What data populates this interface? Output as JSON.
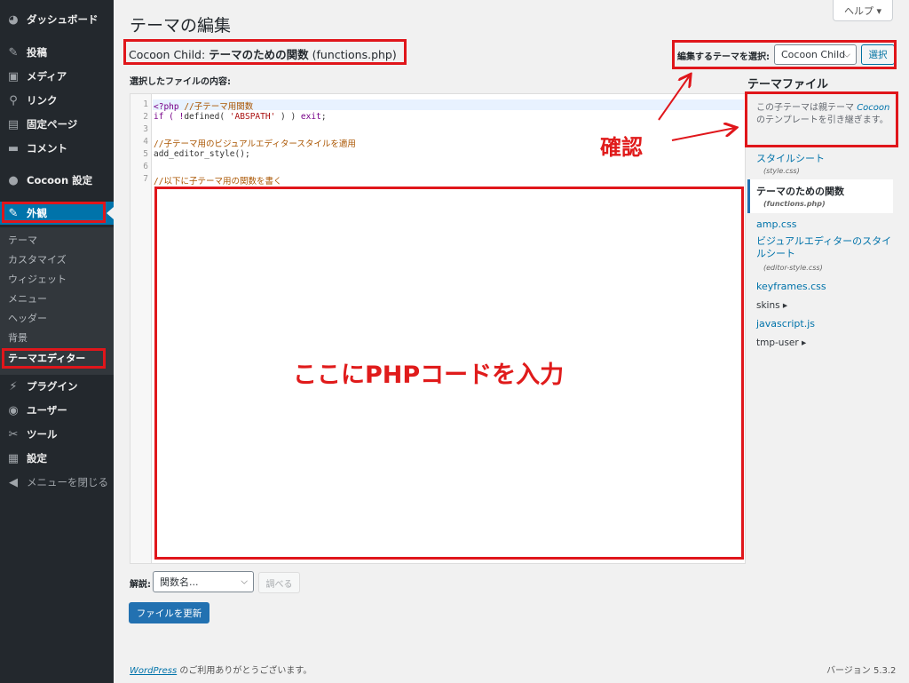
{
  "sidebar": {
    "items": [
      {
        "label": "ダッシュボード",
        "icon": "dashboard-icon",
        "glyph": "◕"
      },
      {
        "label": "投稿",
        "icon": "pin-icon",
        "glyph": "✎"
      },
      {
        "label": "メディア",
        "icon": "media-icon",
        "glyph": "▣"
      },
      {
        "label": "リンク",
        "icon": "link-icon",
        "glyph": "⚲"
      },
      {
        "label": "固定ページ",
        "icon": "page-icon",
        "glyph": "▤"
      },
      {
        "label": "コメント",
        "icon": "comment-icon",
        "glyph": "▬"
      },
      {
        "label": "Cocoon 設定",
        "icon": "circle-icon",
        "glyph": "●"
      },
      {
        "label": "外観",
        "icon": "appearance-icon",
        "glyph": "✎"
      },
      {
        "label": "プラグイン",
        "icon": "plugin-icon",
        "glyph": "⚡"
      },
      {
        "label": "ユーザー",
        "icon": "user-icon",
        "glyph": "◉"
      },
      {
        "label": "ツール",
        "icon": "tools-icon",
        "glyph": "✂"
      },
      {
        "label": "設定",
        "icon": "settings-icon",
        "glyph": "▦"
      },
      {
        "label": "メニューを閉じる",
        "icon": "collapse-icon",
        "glyph": "◀"
      }
    ],
    "submenu": [
      "テーマ",
      "カスタマイズ",
      "ウィジェット",
      "メニュー",
      "ヘッダー",
      "背景",
      "テーマエディター"
    ]
  },
  "header": {
    "title": "テーマの編集",
    "help": "ヘルプ ▾"
  },
  "file_heading": {
    "prefix": "Cocoon Child: ",
    "name": "テーマのための関数",
    "file": " (functions.php)"
  },
  "theme_select": {
    "label": "編集するテーマを選択:",
    "value": "Cocoon Child",
    "button": "選択"
  },
  "content_label": "選択したファイルの内容:",
  "editor": {
    "line_numbers": [
      "1",
      "2",
      "3",
      "4",
      "5",
      "6",
      "7"
    ],
    "lines": {
      "l1a": "<?php ",
      "l1b": "//子テーマ用関数",
      "l2a": "if ( !",
      "l2b": "defined",
      "l2c": "( ",
      "l2d": "'ABSPATH'",
      "l2e": " ) ) ",
      "l2f": "exit",
      "l2g": ";",
      "l4": "//子テーマ用のビジュアルエディタースタイルを適用",
      "l5": "add_editor_style();",
      "l7": "//以下に子テーマ用の関数を書く"
    }
  },
  "annotations": {
    "input_here": "ここにPHPコードを入力",
    "confirm": "確認"
  },
  "theme_files": {
    "title": "テーマファイル",
    "desc_a": "この子テーマは親テーマ ",
    "desc_parent": "Cocoon",
    "desc_b": " のテンプレートを引き継ぎます。",
    "items": [
      {
        "label": "スタイルシート",
        "sub": "(style.css)"
      },
      {
        "label": "テーマのための関数",
        "sub": "(functions.php)"
      },
      {
        "label": "amp.css",
        "sub": ""
      },
      {
        "label": "ビジュアルエディターのスタイルシート",
        "sub": "(editor-style.css)"
      },
      {
        "label": "keyframes.css",
        "sub": ""
      },
      {
        "label": "skins ▸",
        "sub": ""
      },
      {
        "label": "javascript.js",
        "sub": ""
      },
      {
        "label": "tmp-user ▸",
        "sub": ""
      }
    ]
  },
  "doc": {
    "label": "解説:",
    "placeholder": "関数名...",
    "lookup": "調べる"
  },
  "update_button": "ファイルを更新",
  "footer": {
    "wp": "WordPress",
    "thanks": " のご利用ありがとうございます。",
    "version": "バージョン 5.3.2"
  },
  "colors": {
    "sidebar_bg": "#23282d",
    "accent": "#0073aa",
    "annotation_red": "#e0161b"
  }
}
